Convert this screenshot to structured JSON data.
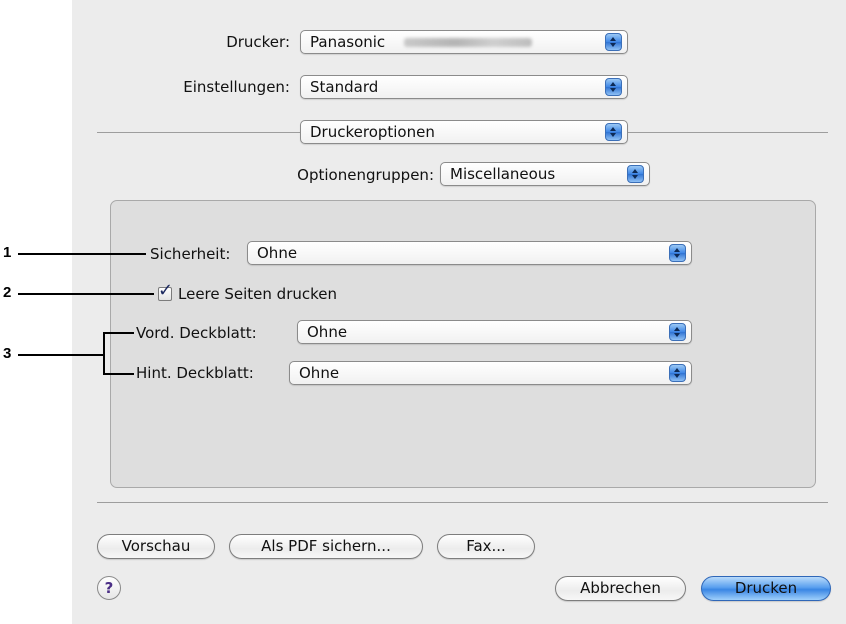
{
  "printer": {
    "label": "Drucker:",
    "value": "Panasonic"
  },
  "presets": {
    "label": "Einstellungen:",
    "value": "Standard"
  },
  "pane_menu": {
    "value": "Druckeroptionen"
  },
  "option_groups": {
    "label": "Optionengruppen:",
    "value": "Miscellaneous"
  },
  "options": {
    "security": {
      "label": "Sicherheit:",
      "value": "Ohne"
    },
    "blank_pages": {
      "label": "Leere Seiten drucken",
      "checked": true,
      "check_glyph": "✓"
    },
    "front_cover": {
      "label": "Vord. Deckblatt:",
      "value": "Ohne"
    },
    "back_cover": {
      "label": "Hint. Deckblatt:",
      "value": "Ohne"
    }
  },
  "buttons": {
    "preview": "Vorschau",
    "save_pdf": "Als PDF sichern...",
    "fax": "Fax...",
    "cancel": "Abbrechen",
    "print": "Drucken",
    "help": "?"
  },
  "callouts": {
    "c1": "1",
    "c2": "2",
    "c3": "3"
  },
  "colors": {
    "accent_blue": "#3a86e4",
    "dialog_bg": "#ececec",
    "panel_bg": "#dedede"
  }
}
